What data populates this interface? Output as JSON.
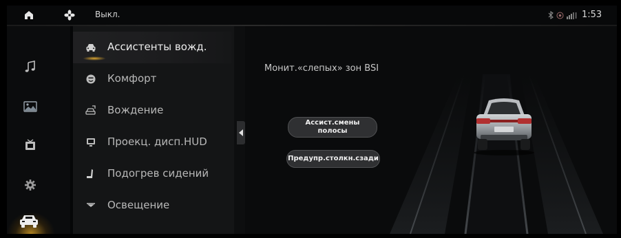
{
  "status_bar": {
    "home_icon": "home-icon",
    "fan_icon": "fan-icon",
    "fan_label": "Выкл.",
    "clock": "1:53",
    "icons": [
      "bluetooth-icon",
      "record-icon",
      "signal-icon"
    ]
  },
  "rail": {
    "items": [
      {
        "icon": "music-icon"
      },
      {
        "icon": "gallery-icon"
      },
      {
        "icon": "video-icon"
      },
      {
        "icon": "gear-icon"
      },
      {
        "icon": "car-icon",
        "active": true
      }
    ],
    "accent_color": "#E6AA28"
  },
  "menu": {
    "items": [
      {
        "label": "Ассистенты вожд.",
        "icon": "driver-assist-icon",
        "active": true
      },
      {
        "label": "Комфорт",
        "icon": "comfort-icon"
      },
      {
        "label": "Вождение",
        "icon": "driving-icon"
      },
      {
        "label": "Проекц. дисп.HUD",
        "icon": "hud-icon"
      },
      {
        "label": "Подогрев сидений",
        "icon": "seat-heat-icon"
      },
      {
        "label": "Освещение",
        "icon": "lighting-icon"
      }
    ]
  },
  "content": {
    "section_title": "Монит.«слепых» зон BSI",
    "lane_assist_line1": "Ассист.смены",
    "lane_assist_line2": "полосы",
    "rear_collision_label": "Предупр.столкн.сзади"
  }
}
